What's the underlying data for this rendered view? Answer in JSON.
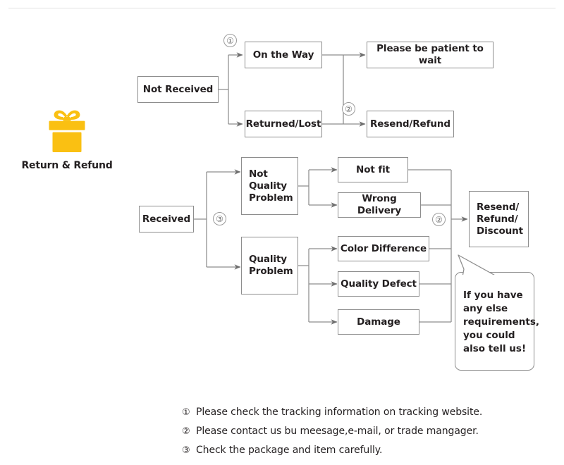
{
  "brand": {
    "icon": "gift-box-icon",
    "icon_color": "#FAC012",
    "label": "Return & Refund"
  },
  "theme": {
    "border_color": "#8d8d8d",
    "text_color": "#231f20",
    "marker_color": "#6f6f6f",
    "rule_color": "#e2e2e2"
  },
  "flow": {
    "not_received": {
      "label": "Not Received",
      "branches": {
        "on_the_way": {
          "label": "On the Way",
          "marker": "①",
          "result": "Please be patient to wait"
        },
        "returned_lost": {
          "label": "Returned/Lost",
          "marker": "②",
          "result": "Resend/Refund"
        }
      }
    },
    "received": {
      "label": "Received",
      "marker": "③",
      "branches": {
        "not_quality_problem": {
          "label": "Not\nQuality\nProblem",
          "reasons": [
            "Not fit",
            "Wrong Delivery"
          ]
        },
        "quality_problem": {
          "label": "Quality\nProblem",
          "reasons": [
            "Color Difference",
            "Quality Defect",
            "Damage"
          ]
        }
      },
      "merge_marker": "②",
      "outcome": "Resend/\nRefund/\nDiscount"
    }
  },
  "bubble": {
    "text": "If you have\nany else\nrequirements,\nyou could\nalso tell us!"
  },
  "footnotes": [
    {
      "marker": "①",
      "text": "Please check the tracking information on tracking website."
    },
    {
      "marker": "②",
      "text": "Please contact us bu meesage,e-mail, or trade mangager."
    },
    {
      "marker": "③",
      "text": "Check the package and item carefully."
    }
  ]
}
